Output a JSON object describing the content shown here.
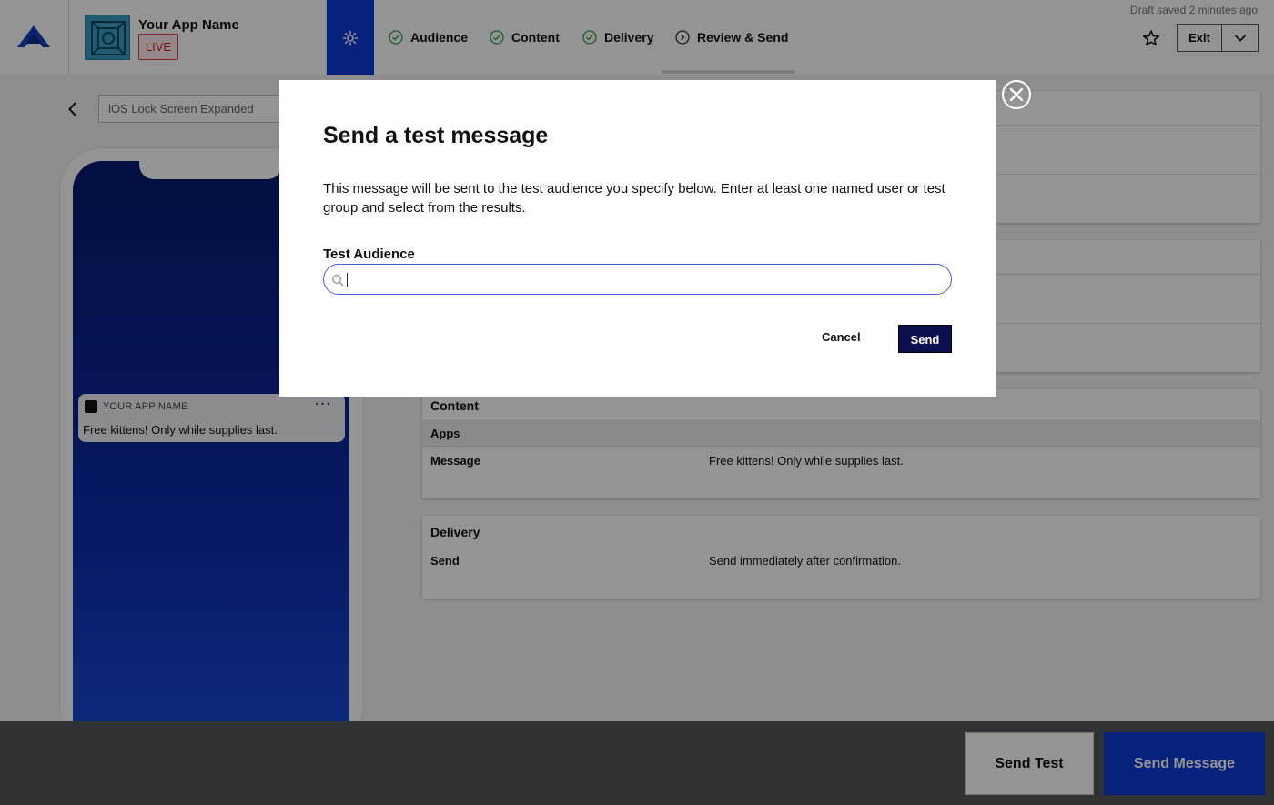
{
  "header": {
    "app_name": "Your App Name",
    "live_badge": "LIVE",
    "draft_status": "Draft saved 2 minutes ago",
    "steps": [
      {
        "label": "Audience",
        "state": "complete"
      },
      {
        "label": "Content",
        "state": "complete"
      },
      {
        "label": "Delivery",
        "state": "complete"
      },
      {
        "label": "Review & Send",
        "state": "current"
      }
    ],
    "exit_label": "Exit"
  },
  "preview": {
    "select_value": "iOS Lock Screen Expanded",
    "notification_app": "YOUR APP NAME",
    "notification_more": "···",
    "notification_message": "Free kittens! Only while supplies last."
  },
  "review": {
    "content": {
      "title": "Content",
      "sub": "Apps",
      "message_label": "Message",
      "message_value": "Free kittens! Only while supplies last."
    },
    "delivery": {
      "title": "Delivery",
      "send_label": "Send",
      "send_value": "Send immediately after confirmation."
    }
  },
  "footer": {
    "send_test": "Send Test",
    "send_message": "Send Message"
  },
  "modal": {
    "title": "Send a test message",
    "description": "This message will be sent to the test audience you specify below. Enter at least one named user or test group and select from the results.",
    "field_label": "Test Audience",
    "search_value": "",
    "cancel": "Cancel",
    "send": "Send"
  },
  "colors": {
    "accent": "#0b3bd6",
    "modal_send": "#0b0f4e",
    "live": "#d02020",
    "check": "#2e9e4a"
  }
}
